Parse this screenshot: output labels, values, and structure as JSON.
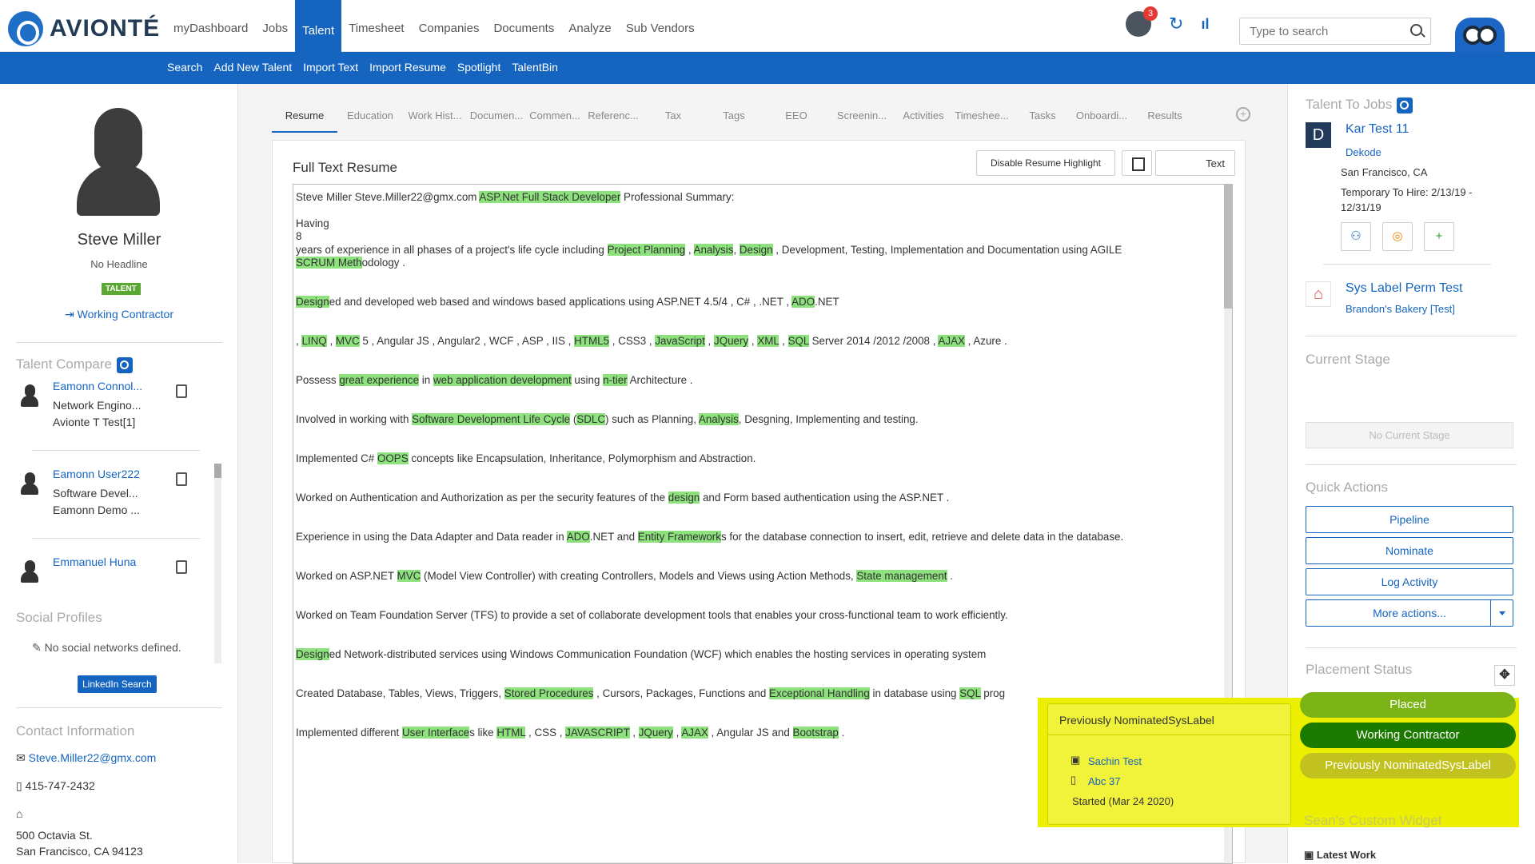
{
  "brand": {
    "name": "AVIONTÉ"
  },
  "nav": {
    "items": [
      "myDashboard",
      "Jobs",
      "Talent",
      "Timesheet",
      "Companies",
      "Documents",
      "Analyze",
      "Sub Vendors"
    ],
    "active": "Talent"
  },
  "subnav": {
    "items": [
      "Search",
      "Add New Talent",
      "Import Text",
      "Import Resume",
      "Spotlight",
      "TalentBin"
    ]
  },
  "header": {
    "notification_count": "3",
    "search_placeholder": "Type to search"
  },
  "profile": {
    "name": "Steve Miller",
    "headline": "No Headline",
    "tag": "TALENT",
    "status": "Working Contractor"
  },
  "talent_compare": {
    "title": "Talent Compare",
    "items": [
      {
        "name": "Eamonn Connol...",
        "line2": "Network Engino...",
        "line3": "Avionte T Test[1]"
      },
      {
        "name": "Eamonn User222",
        "line2": "Software Devel...",
        "line3": "Eamonn Demo ..."
      },
      {
        "name": "Emmanuel Huna",
        "line2": "",
        "line3": ""
      }
    ]
  },
  "social": {
    "title": "Social Profiles",
    "empty": "No social networks defined.",
    "linkedin": "LinkedIn Search"
  },
  "contact": {
    "title": "Contact Information",
    "email": "Steve.Miller22@gmx.com",
    "phone": "415-747-2432",
    "address1": "500 Octavia St.",
    "address2": "San Francisco, CA 94123"
  },
  "tabs": [
    "Resume",
    "Education",
    "Work Hist...",
    "Documen...",
    "Commen...",
    "Referenc...",
    "Tax",
    "Tags",
    "EEO",
    "Screenin...",
    "Activities",
    "Timeshee...",
    "Tasks",
    "Onboardi...",
    "Results"
  ],
  "resume": {
    "title": "Full Text Resume",
    "disable_button": "Disable Resume Highlight",
    "toggle_label": "Text",
    "lines": [
      [
        [
          "Steve Miller Steve.Miller22@gmx.com ",
          0
        ],
        [
          "ASP.Net Full Stack Developer",
          1
        ],
        [
          " Professional Summary:",
          0
        ]
      ],
      [
        [
          "Having",
          0
        ]
      ],
      [
        [
          "8",
          0
        ]
      ],
      [
        [
          " years of experience in all phases of a project's life cycle including ",
          0
        ],
        [
          "Project Planning",
          1
        ],
        [
          " , ",
          0
        ],
        [
          "Analysis",
          1
        ],
        [
          ", ",
          0
        ],
        [
          "Design",
          1
        ],
        [
          " , Development, Testing, Implementation and Documentation using AGILE ",
          0
        ],
        [
          "          ",
          1
        ]
      ],
      [
        [
          "SCRUM Meth",
          1
        ],
        [
          "odology .",
          0
        ]
      ],
      [
        [
          "Design",
          1
        ],
        [
          "ed and developed web based and windows based applications using ASP.NET 4.5/4 , C# , .NET , ",
          0
        ],
        [
          "ADO",
          1
        ],
        [
          ".NET",
          0
        ]
      ],
      [
        [
          ", ",
          0
        ],
        [
          "LINQ",
          1
        ],
        [
          " , ",
          0
        ],
        [
          "MVC",
          1
        ],
        [
          " 5  , Angular JS , Angular2 , WCF , ASP , IIS , ",
          0
        ],
        [
          "HTML5",
          1
        ],
        [
          " , CSS3 , ",
          0
        ],
        [
          "JavaScript",
          1
        ],
        [
          " , ",
          0
        ],
        [
          "JQuery",
          1
        ],
        [
          " , ",
          0
        ],
        [
          "XML",
          1
        ],
        [
          " , ",
          0
        ],
        [
          "SQL",
          1
        ],
        [
          " Server 2014 /2012 /2008 , ",
          0
        ],
        [
          "AJAX",
          1
        ],
        [
          " , Azure .",
          0
        ]
      ],
      [
        [
          "Possess ",
          0
        ],
        [
          "great experience",
          1
        ],
        [
          "  in ",
          0
        ],
        [
          "web application development",
          1
        ],
        [
          "  using ",
          0
        ],
        [
          "n-tier",
          1
        ],
        [
          " Architecture .",
          0
        ]
      ],
      [
        [
          "Involved in working with ",
          0
        ],
        [
          "Software Development Life Cycle",
          1
        ],
        [
          " (",
          0
        ],
        [
          "SDLC",
          1
        ],
        [
          ")  such as Planning, ",
          0
        ],
        [
          "Analysis",
          1
        ],
        [
          ", Desgning, Implementing and testing.",
          0
        ]
      ],
      [
        [
          "Implemented C# ",
          0
        ],
        [
          "OOPS",
          1
        ],
        [
          " concepts like Encapsulation, Inheritance, Polymorphism and Abstraction.",
          0
        ]
      ],
      [
        [
          "Worked on Authentication and Authorization as per the security features of the ",
          0
        ],
        [
          "design",
          1
        ],
        [
          " and Form based authentication using the ASP.NET .",
          0
        ]
      ],
      [
        [
          "Experience in using the Data Adapter and Data reader in ",
          0
        ],
        [
          "ADO",
          1
        ],
        [
          ".NET  and ",
          0
        ],
        [
          "Entity Framework",
          1
        ],
        [
          "s for the database connection to insert, edit, retrieve and delete data in the database.",
          0
        ]
      ],
      [
        [
          "Worked on ASP.NET ",
          0
        ],
        [
          "MVC",
          1
        ],
        [
          " (Model View Controller)  with creating Controllers, Models and Views using Action Methods, ",
          0
        ],
        [
          "State management",
          1
        ],
        [
          " .",
          0
        ]
      ],
      [
        [
          "Worked on Team Foundation Server (TFS)  to provide a set of collaborate development tools that enables your cross-functional team to work efficiently.",
          0
        ]
      ],
      [
        [
          "Design",
          1
        ],
        [
          "ed Network-distributed services using Windows Communication Foundation (WCF)  which enables the hosting services in operating system",
          0
        ]
      ],
      [
        [
          "Created Database, Tables, Views, Triggers, ",
          0
        ],
        [
          "Stored Procedures",
          1
        ],
        [
          " , Cursors, Packages, Functions and ",
          0
        ],
        [
          "Exceptional Handling",
          1
        ],
        [
          "  in database using ",
          0
        ],
        [
          "SQL",
          1
        ],
        [
          " prog",
          0
        ]
      ],
      [
        [
          "Implemented different ",
          0
        ],
        [
          "User Interface",
          1
        ],
        [
          "s  like ",
          0
        ],
        [
          "HTML",
          1
        ],
        [
          " , CSS , ",
          0
        ],
        [
          "JAVASCRIPT",
          1
        ],
        [
          " , ",
          0
        ],
        [
          "JQuery",
          1
        ],
        [
          " , ",
          0
        ],
        [
          "AJAX",
          1
        ],
        [
          " , Angular JS  and ",
          0
        ],
        [
          "Bootstrap",
          1
        ],
        [
          " .",
          0
        ]
      ]
    ]
  },
  "talent_to_jobs": {
    "title": "Talent To Jobs",
    "job1": {
      "logo": "D",
      "title": "Kar Test 11",
      "company": "Dekode",
      "location": "San Francisco, CA",
      "dates1": "Temporary To Hire: 2/13/19 -",
      "dates2": "12/31/19"
    },
    "job2": {
      "title": "Sys Label Perm Test",
      "company": "Brandon's Bakery [Test]"
    }
  },
  "current_stage": {
    "title": "Current Stage",
    "button": "No Current Stage"
  },
  "quick_actions": {
    "title": "Quick Actions",
    "buttons": [
      "Pipeline",
      "Nominate",
      "Log Activity",
      "More actions..."
    ]
  },
  "placement_status": {
    "title": "Placement Status",
    "pills": [
      "Placed",
      "Working Contractor",
      "Previously NominatedSysLabel"
    ]
  },
  "custom_widget": {
    "title": "Sean's Custom Widget",
    "latest": "Latest Work"
  },
  "popup": {
    "title": "Previously NominatedSysLabel",
    "person": "Sachin Test",
    "job": "Abc 37",
    "started": "Started (Mar 24 2020)"
  },
  "colors": {
    "brand_blue": "#1565c0",
    "highlight_green": "#8ee27e",
    "placed": "#7cb317",
    "working": "#1d7a00",
    "prev_nominated": "#c2c21e",
    "annotation_yellow": "#ecf000"
  }
}
